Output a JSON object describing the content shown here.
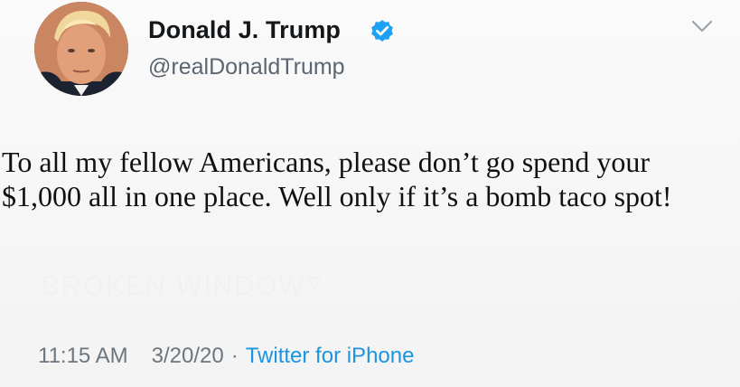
{
  "tweet": {
    "author": {
      "display_name": "Donald J. Trump",
      "handle": "@realDonaldTrump",
      "verified": true
    },
    "text": "To all my fellow Americans, please don’t go spend your $1,000 all in one place. Well only if it’s a bomb taco spot!",
    "faint_background_text": "BROKEN WINDOW?",
    "meta": {
      "time": "11:15 AM",
      "date": "3/20/20",
      "separator": "·",
      "source": "Twitter for iPhone"
    }
  },
  "icons": {
    "verified_badge": "verified-check-icon",
    "menu_caret": "chevron-down-icon"
  },
  "colors": {
    "verified_blue": "#1da1f2",
    "link_blue": "#1b95e0",
    "muted_text": "#6b7680"
  }
}
